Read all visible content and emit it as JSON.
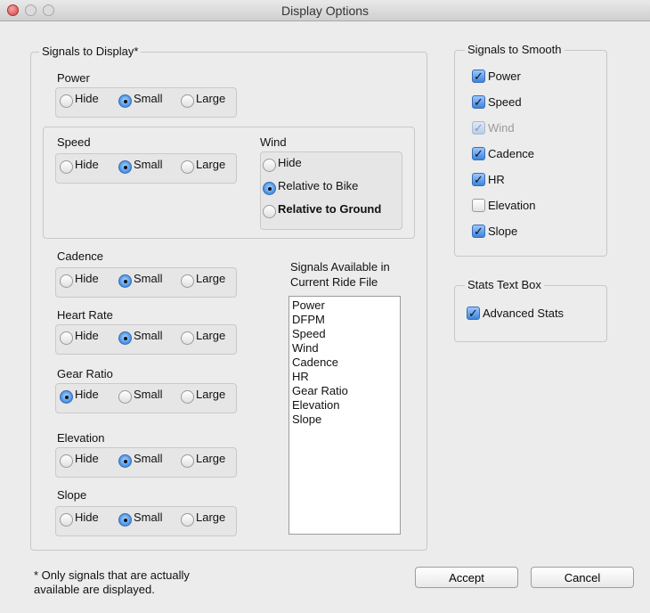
{
  "window": {
    "title": "Display Options"
  },
  "signals_to_display": {
    "legend": "Signals to Display*",
    "radio_options": [
      "Hide",
      "Small",
      "Large"
    ],
    "power": {
      "label": "Power",
      "selected": "Small"
    },
    "speed": {
      "label": "Speed",
      "selected": "Small"
    },
    "wind": {
      "label": "Wind",
      "options": [
        "Hide",
        "Relative to Bike",
        "Relative to Ground"
      ],
      "selected": "Relative to Bike"
    },
    "cadence": {
      "label": "Cadence",
      "selected": "Small"
    },
    "heart_rate": {
      "label": "Heart Rate",
      "selected": "Small"
    },
    "gear_ratio": {
      "label": "Gear Ratio",
      "selected": "Hide"
    },
    "elevation": {
      "label": "Elevation",
      "selected": "Small"
    },
    "slope": {
      "label": "Slope",
      "selected": "Small"
    }
  },
  "signals_available": {
    "label_line1": "Signals Available in",
    "label_line2": "Current Ride File",
    "items": [
      "Power",
      "DFPM",
      "Speed",
      "Wind",
      "Cadence",
      "HR",
      "Gear Ratio",
      "Elevation",
      "Slope"
    ]
  },
  "signals_to_smooth": {
    "legend": "Signals to Smooth",
    "items": [
      {
        "label": "Power",
        "checked": true,
        "enabled": true
      },
      {
        "label": "Speed",
        "checked": true,
        "enabled": true
      },
      {
        "label": "Wind",
        "checked": true,
        "enabled": false
      },
      {
        "label": "Cadence",
        "checked": true,
        "enabled": true
      },
      {
        "label": "HR",
        "checked": true,
        "enabled": true
      },
      {
        "label": "Elevation",
        "checked": false,
        "enabled": true
      },
      {
        "label": "Slope",
        "checked": true,
        "enabled": true
      }
    ]
  },
  "stats_text_box": {
    "legend": "Stats Text Box",
    "advanced_stats": {
      "label": "Advanced Stats",
      "checked": true
    }
  },
  "footnote": {
    "line1": "* Only signals that are actually",
    "line2": "available are displayed."
  },
  "buttons": {
    "accept": "Accept",
    "cancel": "Cancel"
  }
}
